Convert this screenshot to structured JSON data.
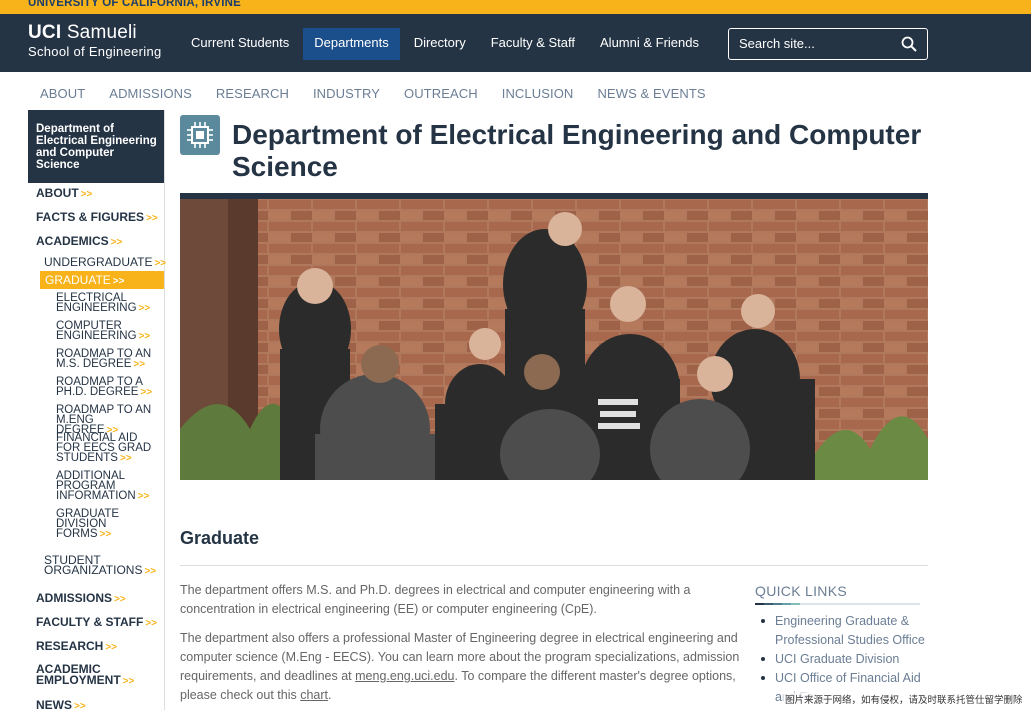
{
  "topbar": {
    "text": "UNIVERSITY OF CALIFORNIA, IRVINE"
  },
  "logo": {
    "line1_bold": "UCI",
    "line1_rest": "Samueli",
    "line2": "School of Engineering"
  },
  "mainnav": [
    "Current Students",
    "Departments",
    "Directory",
    "Faculty & Staff",
    "Alumni & Friends"
  ],
  "search": {
    "placeholder": "Search site..."
  },
  "secnav": [
    "ABOUT",
    "ADMISSIONS",
    "RESEARCH",
    "INDUSTRY",
    "OUTREACH",
    "INCLUSION",
    "NEWS & EVENTS"
  ],
  "sidebar": {
    "heading": "Department of Electrical Engineering and Computer Science",
    "about": "ABOUT",
    "facts": "FACTS & FIGURES",
    "academics": "ACADEMICS",
    "undergraduate": "UNDERGRADUATE",
    "graduate": "GRADUATE",
    "ee": "ELECTRICAL ENGINEERING",
    "ce": "COMPUTER ENGINEERING",
    "roadmap_ms": "ROADMAP TO AN M.S. DEGREE",
    "roadmap_phd": "ROADMAP TO A PH.D. DEGREE",
    "roadmap_meng": "ROADMAP TO AN M.ENG DEGREE",
    "financial_aid": "FINANCIAL AID FOR EECS GRAD STUDENTS",
    "additional": "ADDITIONAL PROGRAM INFORMATION",
    "grad_forms": "GRADUATE DIVISION FORMS",
    "student_orgs": "STUDENT ORGANIZATIONS",
    "admissions": "ADMISSIONS",
    "faculty_staff": "FACULTY & STAFF",
    "research": "RESEARCH",
    "academic_employment": "ACADEMIC EMPLOYMENT",
    "news": "NEWS",
    "arrow": ">>"
  },
  "page": {
    "title": "Department of Electrical Engineering and Computer Science",
    "subhead": "Graduate",
    "para1": "The department offers M.S. and Ph.D. degrees in electrical and computer engineering with a concentration in electrical engineering (EE) or computer engineering (CpE).",
    "para2_a": "The department also offers a professional Master of Engineering degree in electrical engineering and computer science (M.Eng - EECS). You can learn more about the program specializations, admission requirements, and deadlines at ",
    "para2_link": "meng.eng.uci.edu",
    "para2_b": ". To compare the different master's degree options, please check out this ",
    "para2_link2": "chart",
    "para2_c": "."
  },
  "quick_links": {
    "title": "QUICK LINKS",
    "items": [
      "Engineering Graduate & Professional Studies Office",
      "UCI Graduate Division",
      "UCI Office of Financial Aid and Fe"
    ]
  },
  "watermark": "图片来源于网络，如有侵权，请及时联系托管仕留学删除",
  "colors": {
    "navy": "#253445",
    "gold": "#f8b31a",
    "active_blue": "#1b4f8c",
    "icon_teal": "#5b8a9c"
  }
}
